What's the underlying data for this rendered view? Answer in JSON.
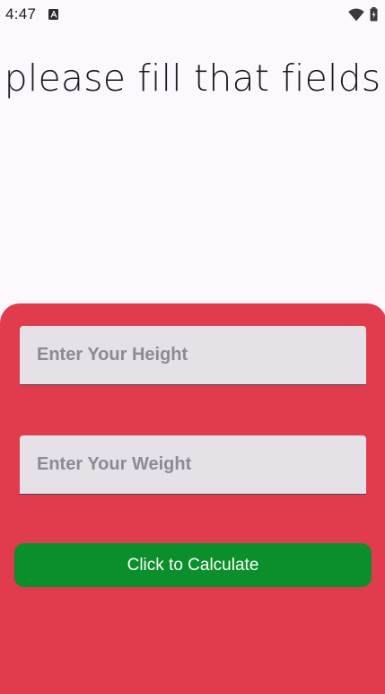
{
  "status_bar": {
    "time": "4:47",
    "icons": [
      "notification-a-icon",
      "wifi-icon",
      "battery-icon"
    ]
  },
  "title": "please fill that fields",
  "form": {
    "height_input": {
      "value": "",
      "placeholder": "Enter Your Height"
    },
    "weight_input": {
      "value": "",
      "placeholder": "Enter Your Weight"
    },
    "calculate_label": "Click to Calculate"
  },
  "colors": {
    "background": "#fdf7fe",
    "panel": "#e03c4e",
    "input_fill": "#e6e1e7",
    "button": "#0a8f2a",
    "button_text": "#ffffff"
  }
}
